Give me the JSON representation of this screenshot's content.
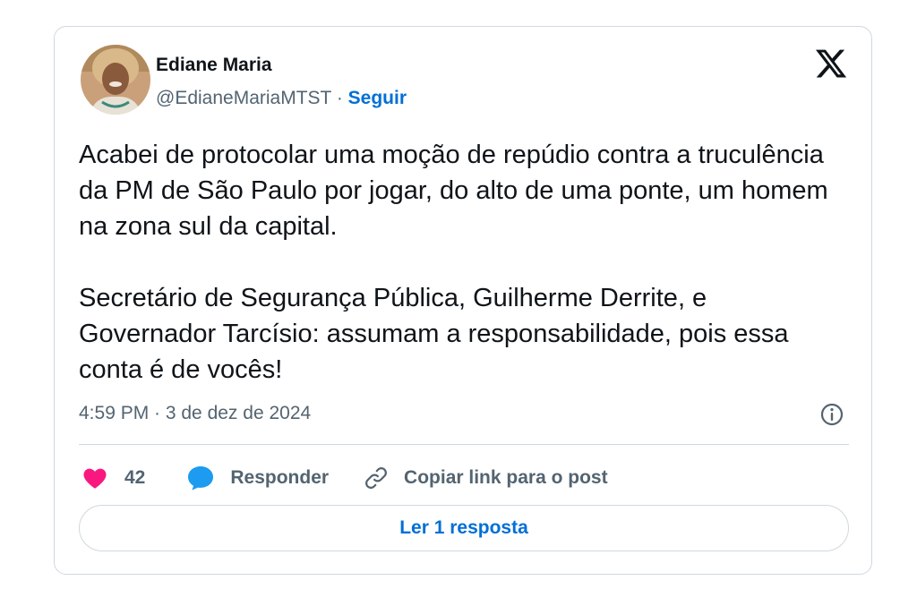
{
  "author": {
    "name": "Ediane Maria",
    "handle": "@EdianeMariaMTST",
    "separator": " · ",
    "follow_label": "Seguir"
  },
  "icons": {
    "brand": "x-logo-icon",
    "info": "info-icon",
    "like": "heart-icon",
    "reply": "reply-bubble-icon",
    "copy_link": "link-icon"
  },
  "tweet": {
    "paragraphs": [
      "Acabei de protocolar uma moção de repúdio contra a truculência da PM de São Paulo por jogar, do alto de uma ponte, um homem na zona sul da capital.",
      "Secretário de Segurança Pública, Guilherme Derrite, e Governador Tarcísio: assumam a responsabilidade, pois essa conta é de vocês!"
    ],
    "timestamp": "4:59 PM · 3 de dez de 2024"
  },
  "actions": {
    "like_count": "42",
    "reply_label": "Responder",
    "copy_link_label": "Copiar link para o post"
  },
  "read_replies_label": "Ler 1 resposta",
  "colors": {
    "text": "#0f1419",
    "secondary": "#536471",
    "link_blue": "#006fd6",
    "heart": "#f91880",
    "reply_blue": "#1d9bf0",
    "border": "#cfd9de"
  }
}
